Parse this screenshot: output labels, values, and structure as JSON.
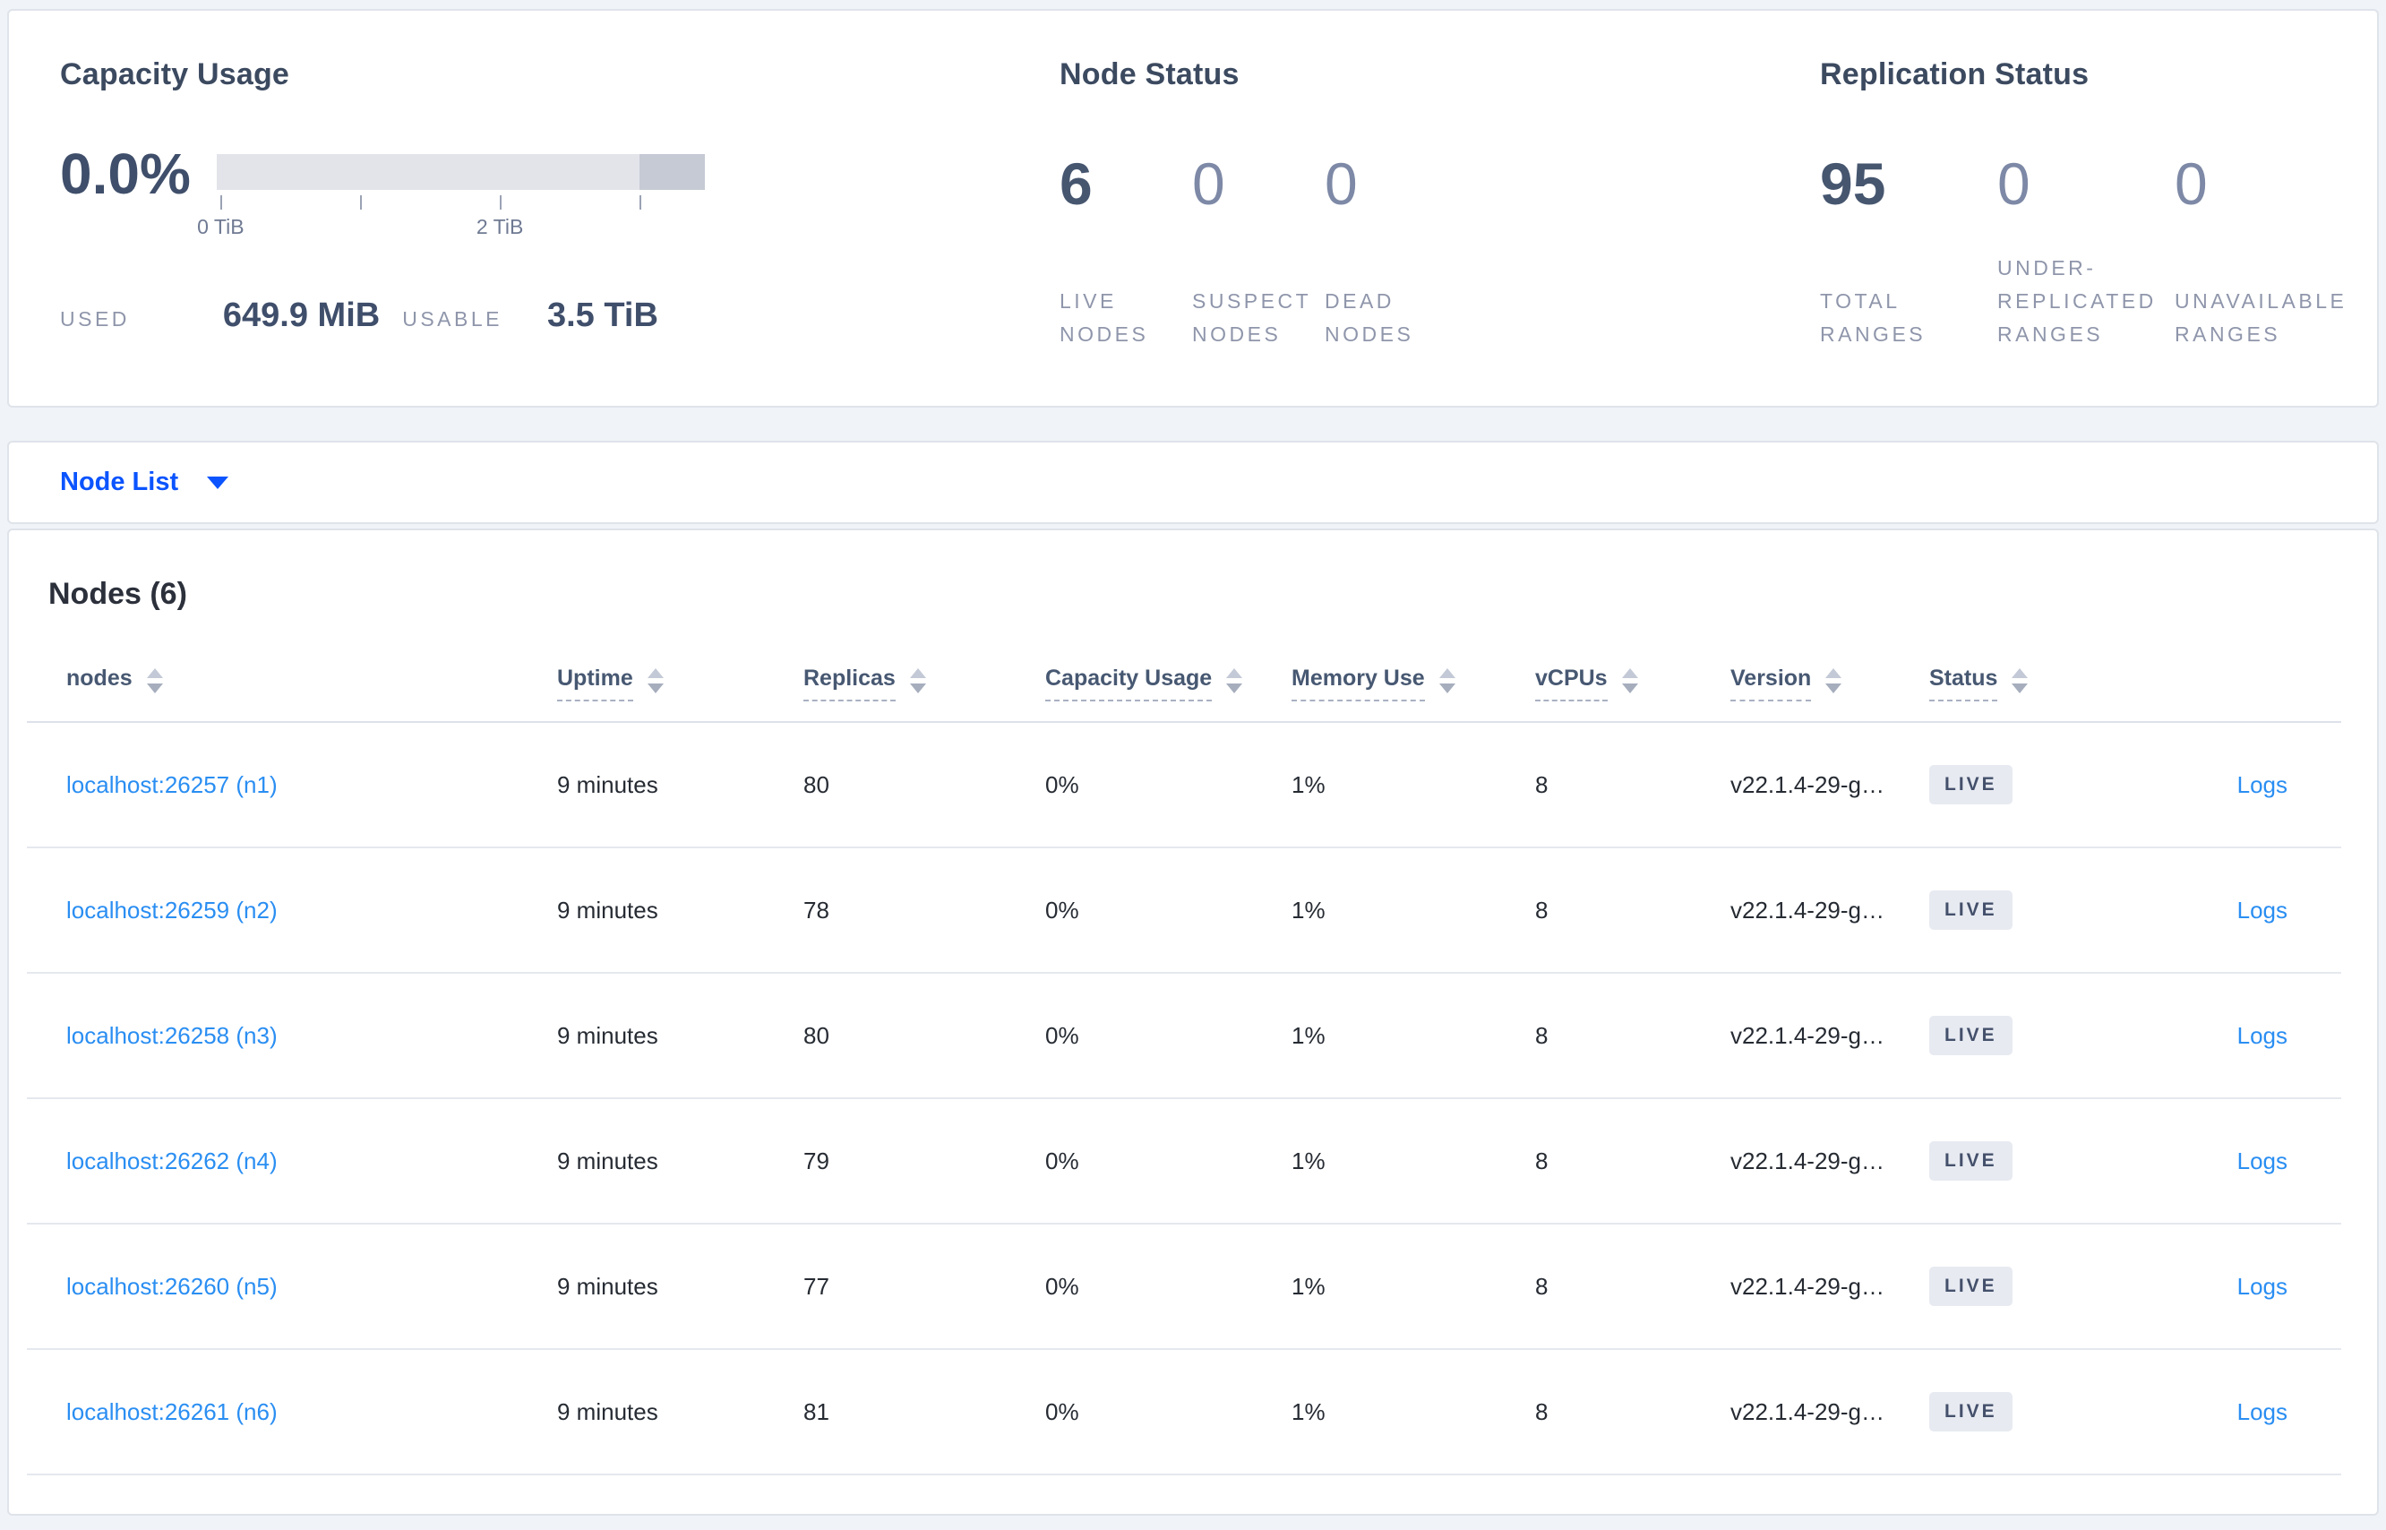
{
  "summary": {
    "capacity": {
      "title": "Capacity Usage",
      "percent": "0.0%",
      "tick_labels": [
        "0 TiB",
        "2 TiB"
      ],
      "stats": [
        {
          "label": "USED",
          "value": "649.9 MiB"
        },
        {
          "label": "USABLE",
          "value": "3.5 TiB"
        }
      ]
    },
    "node_status": {
      "title": "Node Status",
      "metrics": [
        {
          "value": "6",
          "label": "LIVE NODES"
        },
        {
          "value": "0",
          "label": "SUSPECT NODES"
        },
        {
          "value": "0",
          "label": "DEAD NODES"
        }
      ]
    },
    "replication_status": {
      "title": "Replication Status",
      "metrics": [
        {
          "value": "95",
          "label": "TOTAL RANGES"
        },
        {
          "value": "0",
          "label": "UNDER-REPLICATED RANGES"
        },
        {
          "value": "0",
          "label": "UNAVAILABLE RANGES"
        }
      ]
    }
  },
  "view_selector": {
    "label": "Node List"
  },
  "table": {
    "title": "Nodes (6)",
    "columns": [
      {
        "label": "nodes"
      },
      {
        "label": "Uptime"
      },
      {
        "label": "Replicas"
      },
      {
        "label": "Capacity Usage"
      },
      {
        "label": "Memory Use"
      },
      {
        "label": "vCPUs"
      },
      {
        "label": "Version"
      },
      {
        "label": "Status"
      }
    ],
    "rows": [
      {
        "node": "localhost:26257 (n1)",
        "uptime": "9 minutes",
        "replicas": "80",
        "capacity": "0%",
        "memory": "1%",
        "vcpus": "8",
        "version": "v22.1.4-29-g…",
        "status": "LIVE",
        "logs": "Logs"
      },
      {
        "node": "localhost:26259 (n2)",
        "uptime": "9 minutes",
        "replicas": "78",
        "capacity": "0%",
        "memory": "1%",
        "vcpus": "8",
        "version": "v22.1.4-29-g…",
        "status": "LIVE",
        "logs": "Logs"
      },
      {
        "node": "localhost:26258 (n3)",
        "uptime": "9 minutes",
        "replicas": "80",
        "capacity": "0%",
        "memory": "1%",
        "vcpus": "8",
        "version": "v22.1.4-29-g…",
        "status": "LIVE",
        "logs": "Logs"
      },
      {
        "node": "localhost:26262 (n4)",
        "uptime": "9 minutes",
        "replicas": "79",
        "capacity": "0%",
        "memory": "1%",
        "vcpus": "8",
        "version": "v22.1.4-29-g…",
        "status": "LIVE",
        "logs": "Logs"
      },
      {
        "node": "localhost:26260 (n5)",
        "uptime": "9 minutes",
        "replicas": "77",
        "capacity": "0%",
        "memory": "1%",
        "vcpus": "8",
        "version": "v22.1.4-29-g…",
        "status": "LIVE",
        "logs": "Logs"
      },
      {
        "node": "localhost:26261 (n6)",
        "uptime": "9 minutes",
        "replicas": "81",
        "capacity": "0%",
        "memory": "1%",
        "vcpus": "8",
        "version": "v22.1.4-29-g…",
        "status": "LIVE",
        "logs": "Logs"
      }
    ]
  },
  "colors": {
    "accent_blue": "#0b54ff",
    "link_blue": "#2a8ef2",
    "slate_text": "#475872",
    "muted_label": "#8f96ab",
    "badge_bg": "#e7eaf1",
    "bar_track": "#e2e4ea",
    "bar_segment": "#c6cad4"
  }
}
